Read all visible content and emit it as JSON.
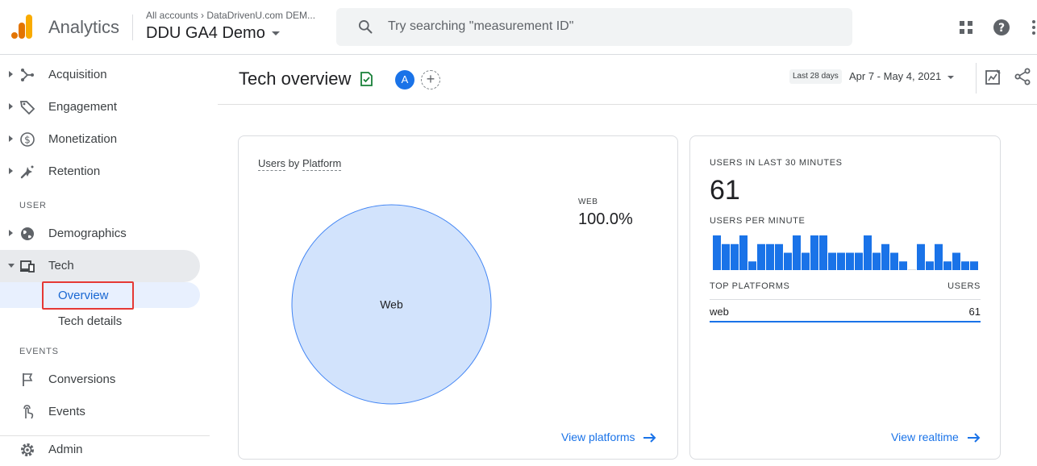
{
  "app": {
    "product_name": "Analytics",
    "breadcrumb": "All accounts › DataDrivenU.com DEM...",
    "property_name": "DDU GA4 Demo",
    "brand_colors": {
      "logo_dark": "#e37400",
      "logo_light": "#f9ab00",
      "accent": "#1a73e8"
    }
  },
  "search": {
    "placeholder": "Try searching \"measurement ID\""
  },
  "topbar_icons": [
    "apps-grid-icon",
    "help-icon",
    "more-vert-icon"
  ],
  "sidebar": {
    "top_items": [
      {
        "label": "Acquisition",
        "icon": "acquisition-icon"
      },
      {
        "label": "Engagement",
        "icon": "engagement-tag-icon"
      },
      {
        "label": "Monetization",
        "icon": "dollar-icon"
      },
      {
        "label": "Retention",
        "icon": "retention-icon"
      }
    ],
    "section_user": "USER",
    "user_items": [
      {
        "label": "Demographics",
        "icon": "globe-icon"
      },
      {
        "label": "Tech",
        "icon": "devices-icon"
      }
    ],
    "tech_subitems": [
      {
        "label": "Overview"
      },
      {
        "label": "Tech details"
      }
    ],
    "section_events": "EVENTS",
    "event_items": [
      {
        "label": "Conversions",
        "icon": "flag-icon"
      },
      {
        "label": "Events",
        "icon": "touch-icon"
      }
    ],
    "admin": {
      "label": "Admin",
      "icon": "gear-icon"
    }
  },
  "header": {
    "title": "Tech overview",
    "comparison_badge": "A",
    "add_comparison": "+",
    "date_chip": "Last 28 days",
    "date_range": "Apr 7 - May 4, 2021"
  },
  "card_platform": {
    "title_part1": "Users",
    "title_by": "by",
    "title_part2": "Platform",
    "legend_label": "WEB",
    "legend_value": "100.0%",
    "view_link": "View platforms",
    "chart_data": {
      "type": "pie",
      "categories": [
        "Web"
      ],
      "values": [
        100.0
      ],
      "slice_labels": [
        "Web"
      ],
      "colors": {
        "fill": "#d2e3fc",
        "stroke": "#4285f4"
      }
    }
  },
  "card_realtime": {
    "label_users30": "USERS IN LAST 30 MINUTES",
    "users30_value": "61",
    "label_per_minute": "USERS PER MINUTE",
    "top_platforms_header": "TOP PLATFORMS",
    "users_header": "USERS",
    "rows": [
      {
        "platform": "web",
        "users": "61"
      }
    ],
    "view_link": "View realtime",
    "chart_data": {
      "type": "bar",
      "categories": [
        "1",
        "2",
        "3",
        "4",
        "5",
        "6",
        "7",
        "8",
        "9",
        "10",
        "11",
        "12",
        "13",
        "14",
        "15",
        "16",
        "17",
        "18",
        "19",
        "20",
        "21",
        "22",
        "23",
        "24",
        "25",
        "26",
        "27",
        "28",
        "29",
        "30"
      ],
      "values": [
        4,
        3,
        3,
        4,
        1,
        3,
        3,
        3,
        2,
        4,
        2,
        4,
        4,
        2,
        2,
        2,
        2,
        4,
        2,
        3,
        2,
        1,
        0,
        3,
        1,
        3,
        1,
        2,
        1,
        1
      ],
      "ylim": [
        0,
        4
      ],
      "colors": {
        "bar": "#1a73e8"
      }
    }
  }
}
